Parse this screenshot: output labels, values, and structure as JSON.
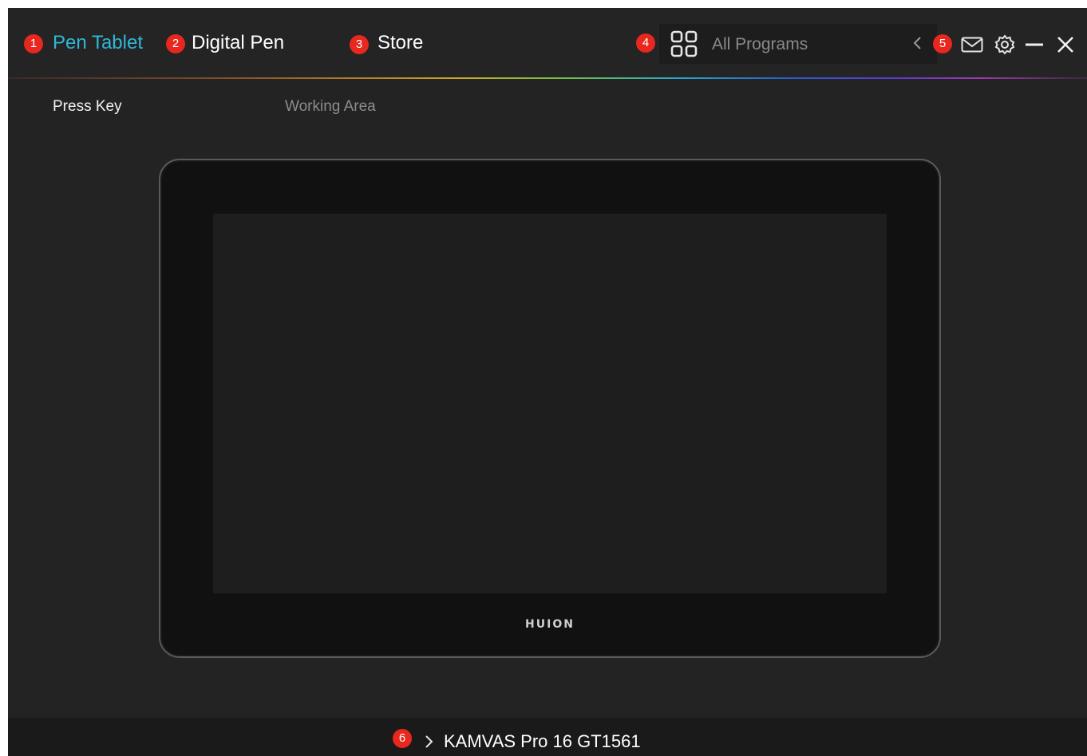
{
  "header": {
    "tabs": [
      {
        "marker": "1",
        "label": "Pen Tablet",
        "active": true
      },
      {
        "marker": "2",
        "label": "Digital Pen",
        "active": false
      },
      {
        "marker": "3",
        "label": "Store",
        "active": false
      }
    ],
    "program_selector": {
      "marker": "4",
      "icon": "grid-icon",
      "label": "All Programs"
    },
    "window_controls": {
      "marker": "5",
      "icons": [
        "chevron-left-icon",
        "mail-icon",
        "gear-icon",
        "minimize-icon",
        "close-icon"
      ]
    }
  },
  "subtabs": [
    {
      "label": "Press Key",
      "active": true
    },
    {
      "label": "Working Area",
      "active": false
    }
  ],
  "device": {
    "logo": "HUION"
  },
  "footer": {
    "marker": "6",
    "icon": "chevron-right-icon",
    "device_name": "KAMVAS Pro 16 GT1561"
  },
  "colors": {
    "accent": "#2fb7d6",
    "marker": "#e8271f",
    "background": "#232323"
  }
}
